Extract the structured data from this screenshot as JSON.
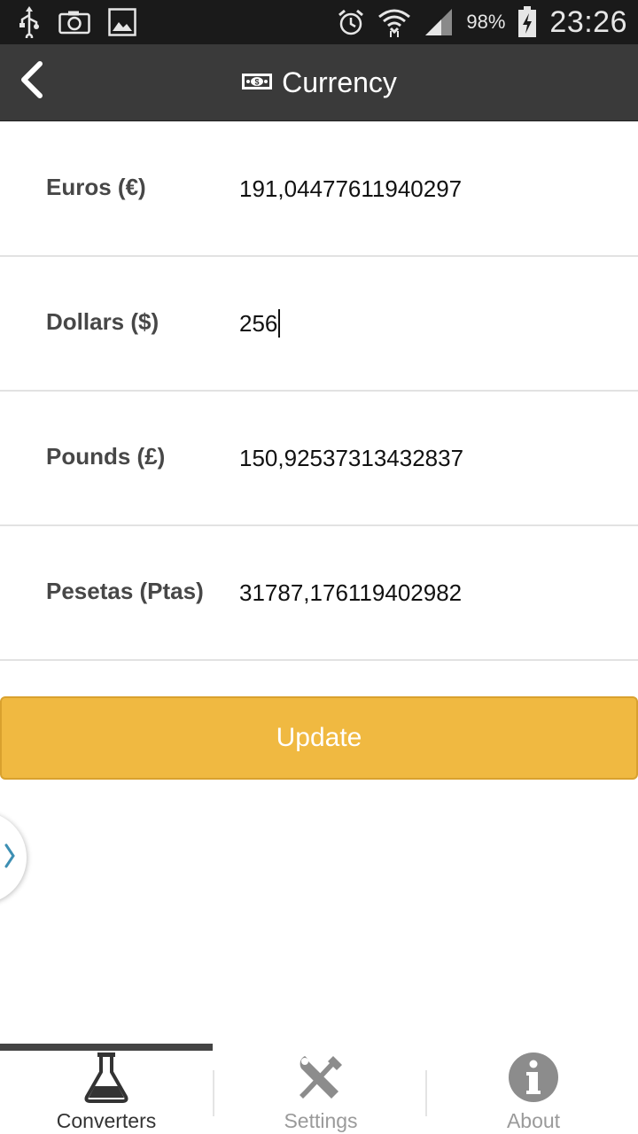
{
  "status_bar": {
    "left_icons": [
      "usb-icon",
      "camera-icon",
      "gallery-icon"
    ],
    "right_icons": [
      "alarm-icon",
      "wifi-icon",
      "signal-icon",
      "battery-charging-icon"
    ],
    "battery_percent": "98%",
    "time": "23:26"
  },
  "app_bar": {
    "back_icon": "chevron-left-icon",
    "title_icon": "banknote-icon",
    "title": "Currency"
  },
  "rows": [
    {
      "label": "Euros (€)",
      "value": "191,04477611940297"
    },
    {
      "label": "Dollars ($)",
      "value": "256",
      "focused": true
    },
    {
      "label": "Pounds (£)",
      "value": "150,92537313432837"
    },
    {
      "label": "Pesetas (Ptas)",
      "value": "31787,176119402982"
    }
  ],
  "update_button": {
    "label": "Update"
  },
  "drawer_handle": {
    "icon": "chevron-right-icon"
  },
  "bottom_nav": {
    "items": [
      {
        "label": "Converters",
        "icon": "flask-icon",
        "active": true
      },
      {
        "label": "Settings",
        "icon": "tools-icon",
        "active": false
      },
      {
        "label": "About",
        "icon": "info-icon",
        "active": false
      }
    ]
  },
  "colors": {
    "status_bar_bg": "#1a1a1a",
    "app_bar_bg": "#3a3a3a",
    "accent_button": "#f0b941",
    "active_nav_text": "#333333",
    "inactive_nav_text": "#9a9a9a"
  }
}
